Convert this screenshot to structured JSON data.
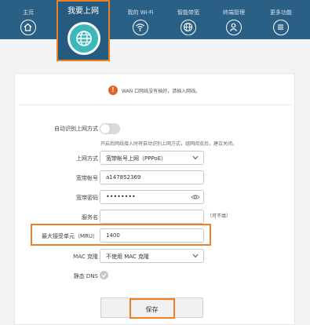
{
  "nav": {
    "items": [
      {
        "label": "主页",
        "icon": "home-icon"
      },
      {
        "label": "我的 Wi-Fi",
        "icon": "wifi-icon"
      },
      {
        "label": "智能带宽",
        "icon": "bandwidth-globe-icon"
      },
      {
        "label": "终端管理",
        "icon": "user-icon"
      },
      {
        "label": "更多功能",
        "icon": "menu-icon"
      }
    ],
    "active": {
      "label": "我要上网",
      "icon": "globe-icon"
    }
  },
  "warning": {
    "text": "WAN 口网线没有插好，请插入网线。"
  },
  "form": {
    "auto_detect": {
      "label": "自动识别上网方式",
      "enabled": false,
      "hint": "开启后网线接入时将自动识别上网方式，组网阅览后，建议关闭。"
    },
    "connection_type": {
      "label": "上网方式",
      "value": "宽带帐号上网（PPPoE）"
    },
    "account": {
      "label": "宽带帐号",
      "value": "a147852369"
    },
    "password": {
      "label": "宽带密码",
      "value": "••••••••"
    },
    "service_name": {
      "label": "服务名",
      "value": "",
      "optional": "（可不填）"
    },
    "mru": {
      "label": "最大接受单元（MRU）",
      "value": "1400"
    },
    "mac_clone": {
      "label": "MAC 克隆",
      "value": "不使用 MAC 克隆"
    },
    "static_dns": {
      "label": "静态 DNS",
      "enabled": true
    }
  },
  "save_label": "保存",
  "colors": {
    "topbar": "#2a5f86",
    "accent_highlight": "#f07f22",
    "globe": "#3cb8bd",
    "warning": "#e4612a"
  }
}
